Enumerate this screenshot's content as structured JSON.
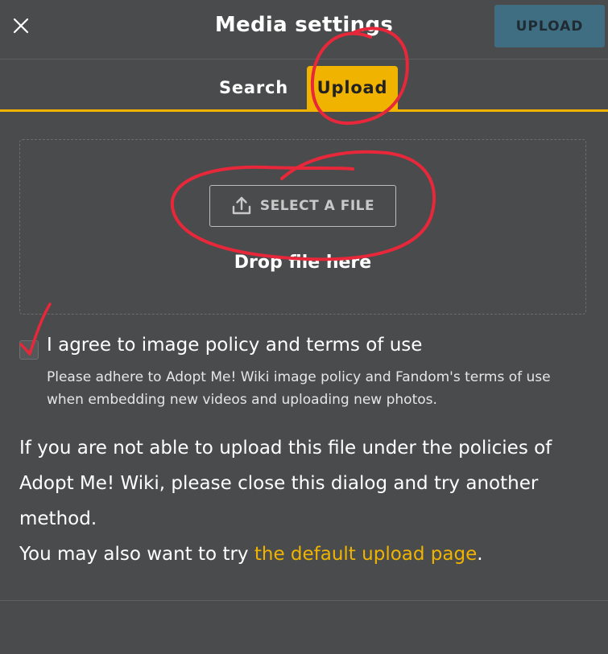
{
  "header": {
    "title": "Media settings",
    "close_icon": "close-icon",
    "upload_button": "UPLOAD"
  },
  "tabs": [
    {
      "label": "Search",
      "active": false
    },
    {
      "label": "Upload",
      "active": true
    }
  ],
  "dropzone": {
    "select_button": "SELECT A FILE",
    "upload_icon": "upload-icon",
    "drop_text": "Drop file here"
  },
  "agreement": {
    "label": "I agree to image policy and terms of use",
    "description": "Please adhere to Adopt Me! Wiki image policy and Fandom's terms of use when embedding new videos and uploading new photos.",
    "checked": false
  },
  "info": {
    "paragraph": "If you are not able to upload this file under the policies of Adopt Me! Wiki, please close this dialog and try another method.",
    "link_prefix": "You may also want to try ",
    "link_text": "the default upload page",
    "link_suffix": "."
  },
  "colors": {
    "background": "#4a4b4c",
    "accent": "#f0b400",
    "upload_button_bg": "#3f6e82",
    "annotation_red": "#e8283a"
  }
}
